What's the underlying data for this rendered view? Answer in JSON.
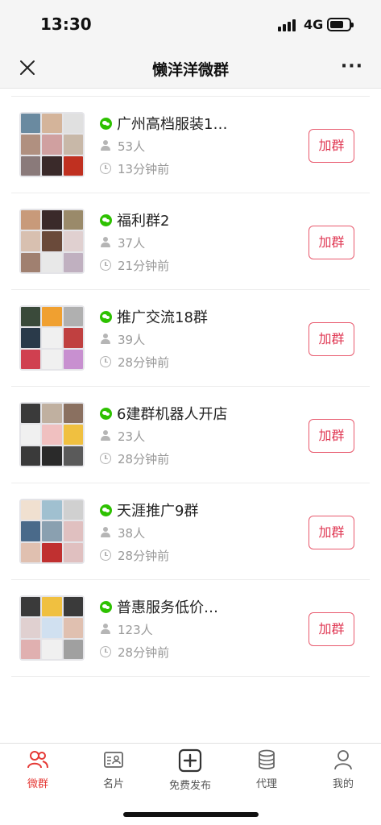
{
  "status_bar": {
    "time": "13:30",
    "network": "4G"
  },
  "nav": {
    "title": "懒洋洋微群"
  },
  "groups": [
    {
      "name": "",
      "members": "39人",
      "time": "13分钟前",
      "join": "加群",
      "thumb": [
        "#3a3a3a",
        "#5a6a3a",
        "#2a2a2a",
        "#c04040",
        "#e8e0d8",
        "#1a1a1a",
        "#e85050",
        "#f0f0f0",
        "#2a2a2a"
      ]
    },
    {
      "name": "广州高档服装1…",
      "members": "53人",
      "time": "13分钟前",
      "join": "加群",
      "thumb": [
        "#6a8aa0",
        "#d4b49a",
        "#e0e0e0",
        "#b09080",
        "#d0a0a0",
        "#c8b8a8",
        "#8a7a7a",
        "#3a2a2a",
        "#c03020"
      ]
    },
    {
      "name": "福利群2",
      "members": "37人",
      "time": "21分钟前",
      "join": "加群",
      "thumb": [
        "#c89a7a",
        "#3a2a2a",
        "#9a8a6a",
        "#d8c0b0",
        "#6a4a3a",
        "#e0d0d0",
        "#a08070",
        "#e8e8e8",
        "#c0b0c0"
      ]
    },
    {
      "name": "推广交流18群",
      "members": "39人",
      "time": "28分钟前",
      "join": "加群",
      "thumb": [
        "#3a4a3a",
        "#f0a030",
        "#b0b0b0",
        "#2a3a4a",
        "#f0f0f0",
        "#c04040",
        "#d04050",
        "#f0f0f0",
        "#c890d0"
      ]
    },
    {
      "name": "6建群机器人开店",
      "members": "23人",
      "time": "28分钟前",
      "join": "加群",
      "thumb": [
        "#3a3a3a",
        "#c0b0a0",
        "#8a7060",
        "#f0f0f0",
        "#f0c0c0",
        "#f0c040",
        "#3a3a3a",
        "#2a2a2a",
        "#5a5a5a"
      ]
    },
    {
      "name": "天涯推广9群",
      "members": "38人",
      "time": "28分钟前",
      "join": "加群",
      "thumb": [
        "#f0e0d0",
        "#a0c0d0",
        "#d0d0d0",
        "#4a6a8a",
        "#8aa0b0",
        "#e0c0c0",
        "#e0c0b0",
        "#c03030",
        "#e0c0c0"
      ]
    },
    {
      "name": "普惠服务低价…",
      "members": "123人",
      "time": "28分钟前",
      "join": "加群",
      "thumb": [
        "#3a3a3a",
        "#f0c040",
        "#3a3a3a",
        "#e0d0d0",
        "#d0e0f0",
        "#e0c0b0",
        "#e0b0b0",
        "#f0f0f0",
        "#a0a0a0"
      ]
    }
  ],
  "tabs": [
    {
      "label": "微群",
      "icon": "group-icon",
      "active": true
    },
    {
      "label": "名片",
      "icon": "card-icon",
      "active": false
    },
    {
      "label": "免费发布",
      "icon": "add-icon",
      "active": false
    },
    {
      "label": "代理",
      "icon": "database-icon",
      "active": false
    },
    {
      "label": "我的",
      "icon": "person-icon",
      "active": false
    }
  ],
  "colors": {
    "accent": "#e53935",
    "wechat_green": "#2dc100",
    "button_border": "#e85a6e"
  }
}
